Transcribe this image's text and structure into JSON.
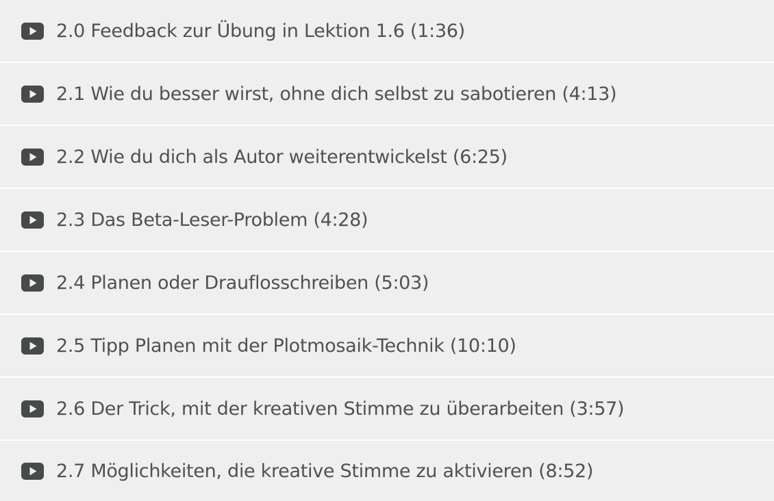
{
  "lessons": [
    {
      "title": "2.0 Feedback zur Übung in Lektion 1.6 (1:36)",
      "icon": "play-video-icon"
    },
    {
      "title": "2.1 Wie du besser wirst, ohne dich selbst zu sabotieren (4:13)",
      "icon": "play-video-icon"
    },
    {
      "title": "2.2 Wie du dich als Autor weiterentwickelst (6:25)",
      "icon": "play-video-icon"
    },
    {
      "title": "2.3 Das Beta-Leser-Problem (4:28)",
      "icon": "play-video-icon"
    },
    {
      "title": "2.4 Planen oder Drauflosschreiben (5:03)",
      "icon": "play-video-icon"
    },
    {
      "title": "2.5 Tipp Planen mit der Plotmosaik-Technik (10:10)",
      "icon": "play-video-icon"
    },
    {
      "title": "2.6 Der Trick, mit der kreativen Stimme zu überarbeiten (3:57)",
      "icon": "play-video-icon"
    },
    {
      "title": "2.7 Möglichkeiten, die kreative Stimme zu aktivieren (8:52)",
      "icon": "play-video-icon"
    }
  ],
  "colors": {
    "row_background": "#efefef",
    "row_divider": "#ffffff",
    "text": "#4f5250",
    "icon": "#464a49"
  }
}
